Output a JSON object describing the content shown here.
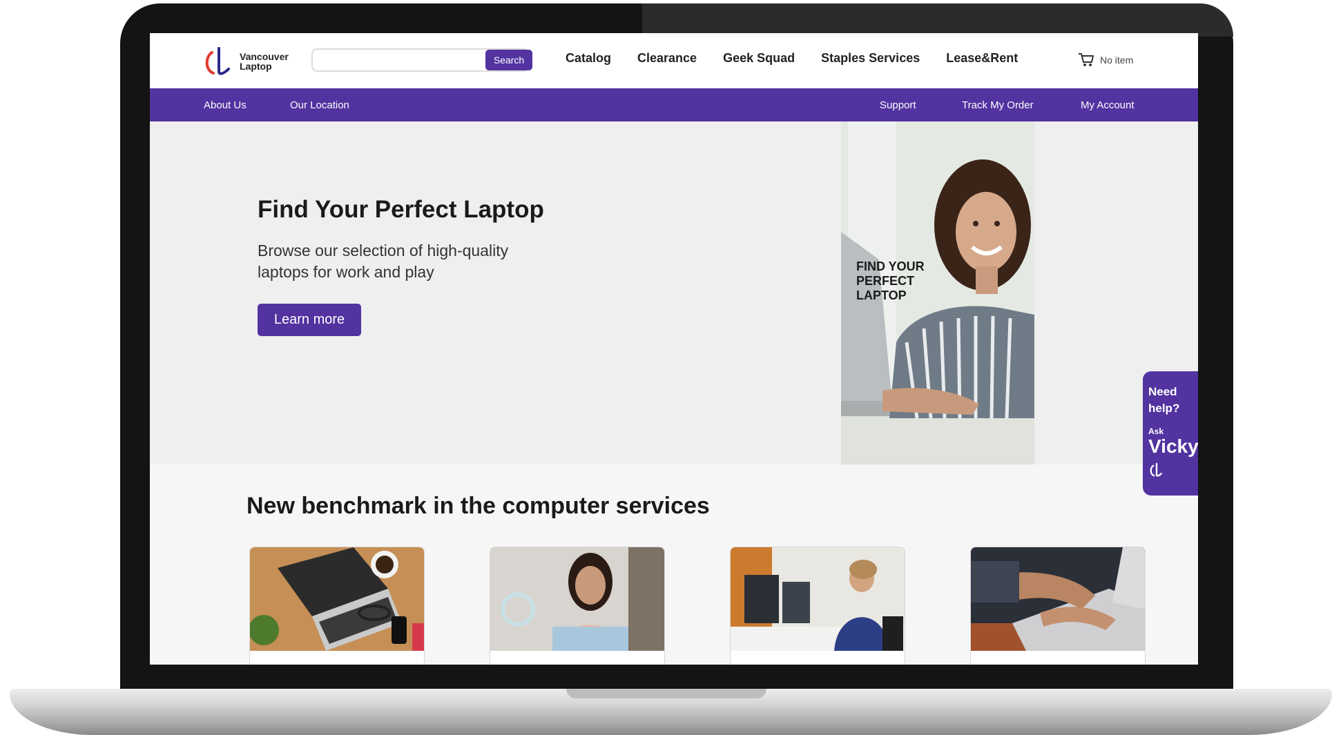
{
  "brand": {
    "name_line1": "Vancouver",
    "name_line2": "Laptop"
  },
  "search": {
    "placeholder": "",
    "button_label": "Search"
  },
  "main_nav": [
    {
      "label": "Catalog"
    },
    {
      "label": "Clearance"
    },
    {
      "label": "Geek Squad"
    },
    {
      "label": "Staples Services"
    },
    {
      "label": "Lease&Rent"
    }
  ],
  "cart": {
    "label": "No item",
    "icon": "cart-icon"
  },
  "subbar": {
    "left": [
      {
        "label": "About Us"
      },
      {
        "label": "Our Location"
      }
    ],
    "right": [
      {
        "label": "Support"
      },
      {
        "label": "Track My Order"
      },
      {
        "label": "My Account"
      }
    ]
  },
  "hero": {
    "title": "Find Your Perfect Laptop",
    "subtitle": "Browse our selection of high-quality laptops for work and play",
    "button_label": "Learn more",
    "image_text": "FIND YOUR\nPERFECT\nLAPTOP"
  },
  "help_widget": {
    "line1": "Need",
    "line2": "help?",
    "ask": "Ask",
    "name": "Vicky"
  },
  "services": {
    "title": "New benchmark in the computer services",
    "cards": [
      {
        "image": "laptop-on-desk-photo"
      },
      {
        "image": "woman-at-laptop-photo"
      },
      {
        "image": "office-worker-photo"
      },
      {
        "image": "typing-hands-photo"
      }
    ]
  },
  "colors": {
    "brand_purple": "#5233a0",
    "logo_red": "#e23a2e",
    "logo_blue": "#2a2a8a"
  }
}
